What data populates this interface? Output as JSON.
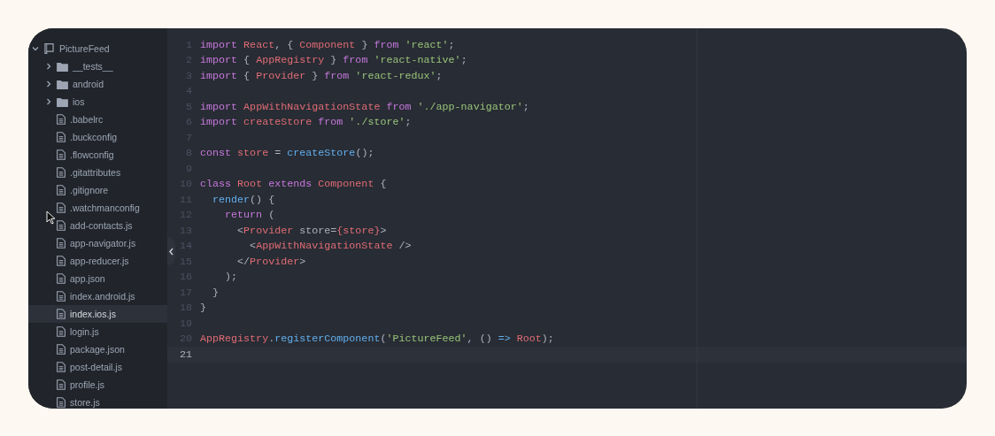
{
  "project_tree": {
    "label": "PictureFeed",
    "kind": "project",
    "expanded": true,
    "children": [
      {
        "label": "__tests__",
        "kind": "folder",
        "expanded": false,
        "selected": false
      },
      {
        "label": "android",
        "kind": "folder",
        "expanded": false,
        "selected": false
      },
      {
        "label": "ios",
        "kind": "folder",
        "expanded": false,
        "selected": false
      },
      {
        "label": ".babelrc",
        "kind": "file",
        "selected": false
      },
      {
        "label": ".buckconfig",
        "kind": "file",
        "selected": false
      },
      {
        "label": ".flowconfig",
        "kind": "file",
        "selected": false
      },
      {
        "label": ".gitattributes",
        "kind": "file",
        "selected": false
      },
      {
        "label": ".gitignore",
        "kind": "file",
        "selected": false
      },
      {
        "label": ".watchmanconfig",
        "kind": "file",
        "selected": false
      },
      {
        "label": "add-contacts.js",
        "kind": "file",
        "selected": false
      },
      {
        "label": "app-navigator.js",
        "kind": "file",
        "selected": false
      },
      {
        "label": "app-reducer.js",
        "kind": "file",
        "selected": false
      },
      {
        "label": "app.json",
        "kind": "file",
        "selected": false
      },
      {
        "label": "index.android.js",
        "kind": "file",
        "selected": false
      },
      {
        "label": "index.ios.js",
        "kind": "file",
        "selected": true
      },
      {
        "label": "login.js",
        "kind": "file",
        "selected": false
      },
      {
        "label": "package.json",
        "kind": "file",
        "selected": false
      },
      {
        "label": "post-detail.js",
        "kind": "file",
        "selected": false
      },
      {
        "label": "profile.js",
        "kind": "file",
        "selected": false
      },
      {
        "label": "store.js",
        "kind": "file",
        "selected": false
      }
    ]
  },
  "editor": {
    "lines": [
      {
        "number": "1",
        "current": false,
        "tokens": [
          {
            "kind": "keyword",
            "text": "import"
          },
          {
            "kind": "name",
            "text": " React"
          },
          {
            "kind": "plain",
            "text": ", { "
          },
          {
            "kind": "name",
            "text": "Component"
          },
          {
            "kind": "plain",
            "text": " } "
          },
          {
            "kind": "keyword",
            "text": "from"
          },
          {
            "kind": "string",
            "text": " 'react'"
          },
          {
            "kind": "plain",
            "text": ";"
          }
        ]
      },
      {
        "number": "2",
        "current": false,
        "tokens": [
          {
            "kind": "keyword",
            "text": "import"
          },
          {
            "kind": "plain",
            "text": " { "
          },
          {
            "kind": "name",
            "text": "AppRegistry"
          },
          {
            "kind": "plain",
            "text": " } "
          },
          {
            "kind": "keyword",
            "text": "from"
          },
          {
            "kind": "string",
            "text": " 'react-native'"
          },
          {
            "kind": "plain",
            "text": ";"
          }
        ]
      },
      {
        "number": "3",
        "current": false,
        "tokens": [
          {
            "kind": "keyword",
            "text": "import"
          },
          {
            "kind": "plain",
            "text": " { "
          },
          {
            "kind": "name",
            "text": "Provider"
          },
          {
            "kind": "plain",
            "text": " } "
          },
          {
            "kind": "keyword",
            "text": "from"
          },
          {
            "kind": "string",
            "text": " 'react-redux'"
          },
          {
            "kind": "plain",
            "text": ";"
          }
        ]
      },
      {
        "number": "4",
        "current": false
      },
      {
        "number": "5",
        "current": false,
        "tokens": [
          {
            "kind": "keyword",
            "text": "import"
          },
          {
            "kind": "name",
            "text": " AppWithNavigationState"
          },
          {
            "kind": "keyword",
            "text": " from"
          },
          {
            "kind": "string",
            "text": " './app-navigator'"
          },
          {
            "kind": "plain",
            "text": ";"
          }
        ]
      },
      {
        "number": "6",
        "current": false,
        "tokens": [
          {
            "kind": "keyword",
            "text": "import"
          },
          {
            "kind": "name",
            "text": " createStore"
          },
          {
            "kind": "keyword",
            "text": " from"
          },
          {
            "kind": "string",
            "text": " './store'"
          },
          {
            "kind": "plain",
            "text": ";"
          }
        ]
      },
      {
        "number": "7",
        "current": false
      },
      {
        "number": "8",
        "current": false,
        "tokens": [
          {
            "kind": "keyword",
            "text": "const"
          },
          {
            "kind": "name",
            "text": " store"
          },
          {
            "kind": "plain",
            "text": " = "
          },
          {
            "kind": "function",
            "text": "createStore"
          },
          {
            "kind": "plain",
            "text": "();"
          }
        ]
      },
      {
        "number": "9",
        "current": false
      },
      {
        "number": "10",
        "current": false,
        "tokens": [
          {
            "kind": "keyword",
            "text": "class"
          },
          {
            "kind": "name",
            "text": " Root"
          },
          {
            "kind": "keyword",
            "text": " extends"
          },
          {
            "kind": "name",
            "text": " Component"
          },
          {
            "kind": "plain",
            "text": " {"
          }
        ]
      },
      {
        "number": "11",
        "current": false,
        "tokens": [
          {
            "kind": "function",
            "text": "  render"
          },
          {
            "kind": "plain",
            "text": "() {"
          }
        ]
      },
      {
        "number": "12",
        "current": false,
        "tokens": [
          {
            "kind": "keyword",
            "text": "    return"
          },
          {
            "kind": "plain",
            "text": " ("
          }
        ]
      },
      {
        "number": "13",
        "current": false,
        "tokens": [
          {
            "kind": "plain",
            "text": "      <"
          },
          {
            "kind": "name",
            "text": "Provider"
          },
          {
            "kind": "plain",
            "text": " store="
          },
          {
            "kind": "name",
            "text": "{store}"
          },
          {
            "kind": "plain",
            "text": ">"
          }
        ]
      },
      {
        "number": "14",
        "current": false,
        "tokens": [
          {
            "kind": "plain",
            "text": "        <"
          },
          {
            "kind": "name",
            "text": "AppWithNavigationState"
          },
          {
            "kind": "plain",
            "text": " />"
          }
        ]
      },
      {
        "number": "15",
        "current": false,
        "tokens": [
          {
            "kind": "plain",
            "text": "      </"
          },
          {
            "kind": "name",
            "text": "Provider"
          },
          {
            "kind": "plain",
            "text": ">"
          }
        ]
      },
      {
        "number": "16",
        "current": false,
        "tokens": [
          {
            "kind": "plain",
            "text": "    );"
          }
        ]
      },
      {
        "number": "17",
        "current": false,
        "tokens": [
          {
            "kind": "plain",
            "text": "  }"
          }
        ]
      },
      {
        "number": "18",
        "current": false,
        "tokens": [
          {
            "kind": "plain",
            "text": "}"
          }
        ]
      },
      {
        "number": "19",
        "current": false
      },
      {
        "number": "20",
        "current": false,
        "tokens": [
          {
            "kind": "name",
            "text": "AppRegistry"
          },
          {
            "kind": "plain",
            "text": "."
          },
          {
            "kind": "function",
            "text": "registerComponent"
          },
          {
            "kind": "plain",
            "text": "("
          },
          {
            "kind": "string",
            "text": "'PictureFeed'"
          },
          {
            "kind": "plain",
            "text": ", () "
          },
          {
            "kind": "function",
            "text": "=>"
          },
          {
            "kind": "name",
            "text": " Root"
          },
          {
            "kind": "plain",
            "text": ");"
          }
        ]
      },
      {
        "number": "21",
        "current": true
      }
    ]
  }
}
